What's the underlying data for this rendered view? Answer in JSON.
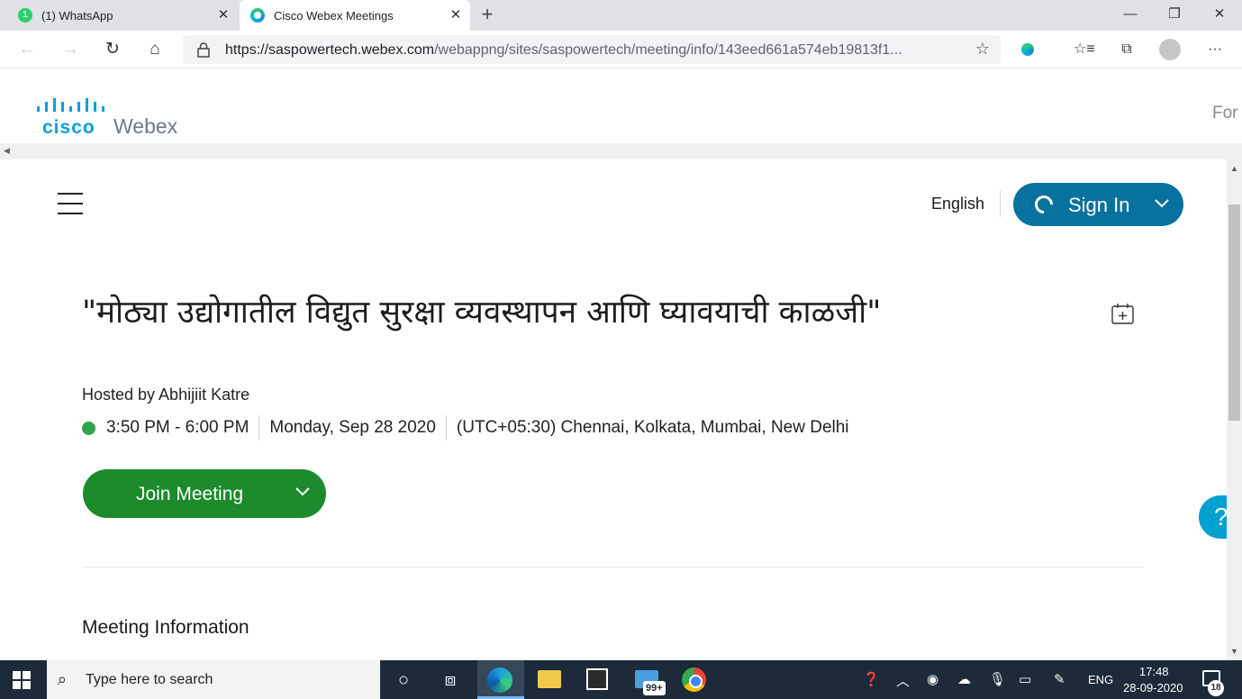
{
  "browser": {
    "tabs": [
      {
        "label": "(1) WhatsApp",
        "badge": "1"
      },
      {
        "label": "Cisco Webex Meetings"
      }
    ],
    "url_host": "https://saspowertech.webex.com",
    "url_path": "/webappng/sites/saspowertech/meeting/info/143eed661a574eb19813f1...",
    "icons": [
      "back-icon",
      "forward-icon",
      "refresh-icon",
      "home-icon",
      "lock-icon",
      "star-icon",
      "favorites-icon",
      "collections-icon",
      "profile-icon",
      "more-icon"
    ]
  },
  "webex_header": {
    "brand_cisco": "cisco",
    "brand_webex": "Webex",
    "right_text": "For"
  },
  "nav": {
    "language": "English",
    "sign_in_label": "Sign In"
  },
  "meeting": {
    "title": "\"मोठ्या उद्योगातील विद्युत सुरक्षा व्यवस्थापन आणि घ्यावयाची काळजी\"",
    "host": "Hosted by Abhijiit Katre",
    "time": "3:50 PM - 6:00 PM",
    "date": "Monday, Sep 28 2020",
    "timezone": "(UTC+05:30) Chennai, Kolkata, Mumbai, New Delhi",
    "join_label": "Join Meeting",
    "info_heading": "Meeting Information"
  },
  "help": {
    "label": "?"
  },
  "taskbar": {
    "search_placeholder": "Type here to search",
    "mail_badge": "99+",
    "language": "ENG",
    "time": "17:48",
    "date": "28-09-2020",
    "notifications": "18"
  },
  "colors": {
    "sign_in_bg": "#07729e",
    "join_bg": "#1d8a2c",
    "live_dot": "#2fa647",
    "help_bg": "#00a0d1",
    "cisco_blue": "#049fd9"
  }
}
